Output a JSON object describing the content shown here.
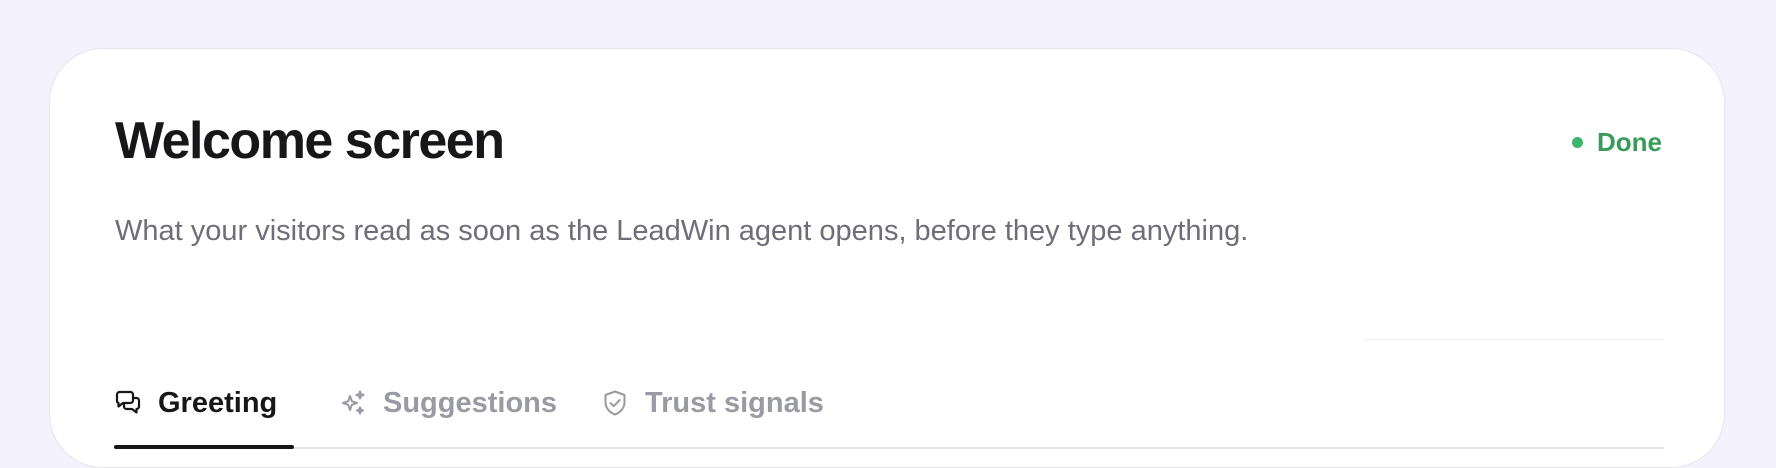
{
  "header": {
    "title": "Welcome screen",
    "subtitle": "What your visitors read as soon as the LeadWin agent opens, before they type anything.",
    "status": {
      "label": "Done",
      "color": "#3fb56c"
    }
  },
  "tabs": [
    {
      "label": "Greeting",
      "icon": "chat-bubbles-icon",
      "active": true
    },
    {
      "label": "Suggestions",
      "icon": "sparkles-icon",
      "active": false
    },
    {
      "label": "Trust signals",
      "icon": "shield-check-icon",
      "active": false
    }
  ],
  "colors": {
    "background": "#f3f2fd",
    "card": "#ffffff",
    "title_text": "#17171a",
    "muted_text": "#6e6e78",
    "inactive_tab": "#9a9aa3",
    "success": "#3a9a5c"
  }
}
